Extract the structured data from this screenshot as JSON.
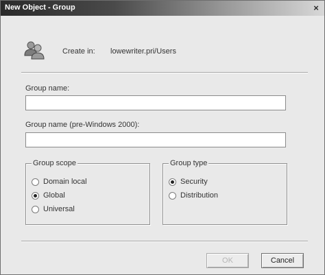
{
  "window": {
    "title": "New Object - Group",
    "close_glyph": "×"
  },
  "header": {
    "icon": "group-users-icon",
    "create_in_label": "Create in:",
    "create_in_value": "lowewriter.pri/Users"
  },
  "fields": {
    "group_name_label": "Group name:",
    "group_name_value": "",
    "group_name_pre2000_label": "Group name (pre-Windows 2000):",
    "group_name_pre2000_value": ""
  },
  "group_scope": {
    "legend": "Group scope",
    "options": [
      {
        "label": "Domain local",
        "checked": false
      },
      {
        "label": "Global",
        "checked": true
      },
      {
        "label": "Universal",
        "checked": false
      }
    ]
  },
  "group_type": {
    "legend": "Group type",
    "options": [
      {
        "label": "Security",
        "checked": true
      },
      {
        "label": "Distribution",
        "checked": false
      }
    ]
  },
  "buttons": {
    "ok_label": "OK",
    "ok_enabled": false,
    "cancel_label": "Cancel"
  },
  "colors": {
    "title_bar_start": "#2a2a2a",
    "title_bar_end": "#d8d8d8",
    "dialog_background": "#e9e9e9"
  }
}
